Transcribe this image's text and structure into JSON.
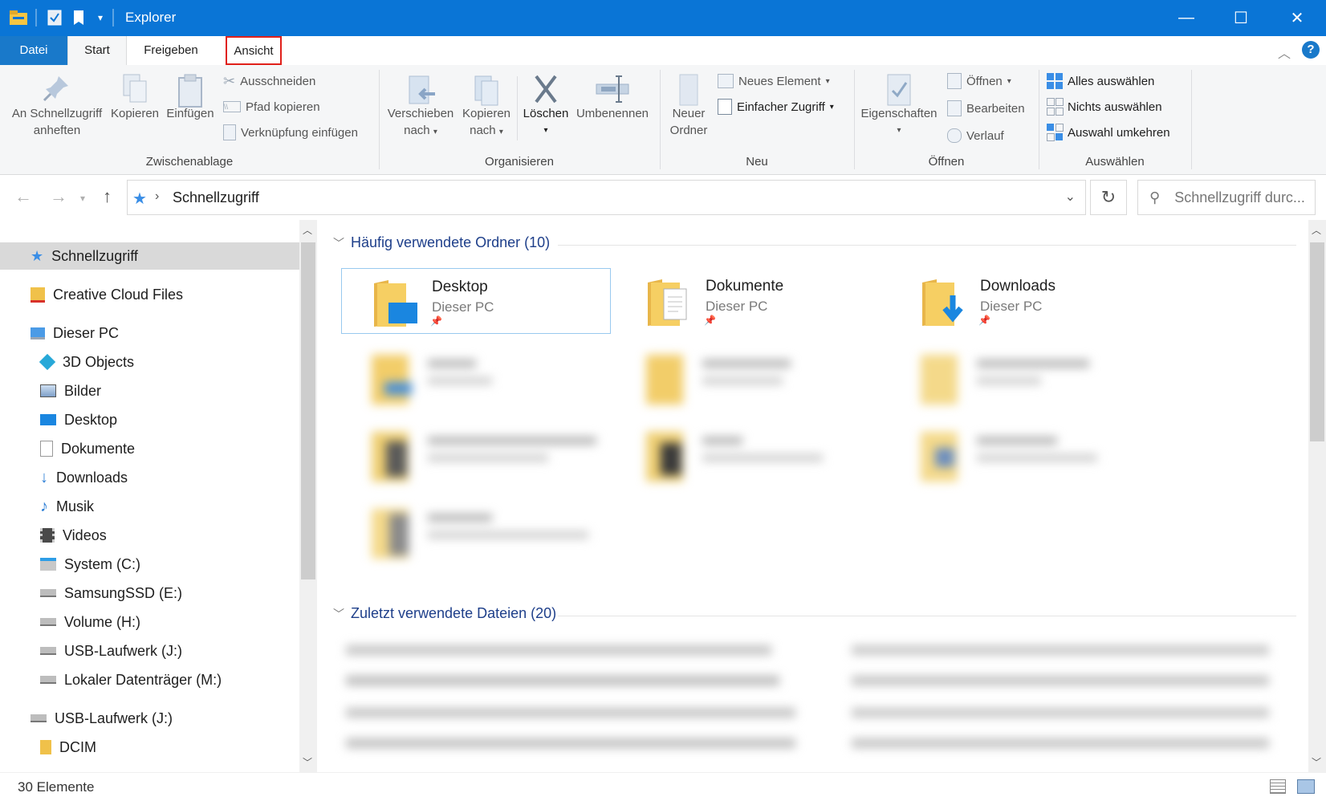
{
  "window": {
    "title": "Explorer",
    "minimize": "—",
    "maximize": "☐",
    "close": "✕"
  },
  "ribbon_tabs": {
    "datei": "Datei",
    "start": "Start",
    "freigeben": "Freigeben",
    "ansicht": "Ansicht"
  },
  "ribbon": {
    "zwischenablage": {
      "label": "Zwischenablage",
      "pin_line1": "An Schnellzugriff",
      "pin_line2": "anheften",
      "copy": "Kopieren",
      "paste": "Einfügen",
      "cut": "Ausschneiden",
      "copy_path": "Pfad kopieren",
      "paste_shortcut": "Verknüpfung einfügen"
    },
    "organisieren": {
      "label": "Organisieren",
      "move_line1": "Verschieben",
      "move_line2": "nach",
      "copyto_line1": "Kopieren",
      "copyto_line2": "nach",
      "delete": "Löschen",
      "rename": "Umbenennen"
    },
    "neu": {
      "label": "Neu",
      "folder_line1": "Neuer",
      "folder_line2": "Ordner",
      "new_item": "Neues Element",
      "easy_access": "Einfacher Zugriff"
    },
    "oeffnen": {
      "label": "Öffnen",
      "properties": "Eigenschaften",
      "open": "Öffnen",
      "edit": "Bearbeiten",
      "history": "Verlauf"
    },
    "auswaehlen": {
      "label": "Auswählen",
      "select_all": "Alles auswählen",
      "select_none": "Nichts auswählen",
      "invert": "Auswahl umkehren"
    }
  },
  "address": {
    "path": "Schnellzugriff",
    "search_placeholder": "Schnellzugriff durc..."
  },
  "nav": {
    "items": [
      {
        "label": "Schnellzugriff"
      },
      {
        "label": "Creative Cloud Files"
      },
      {
        "label": "Dieser PC"
      },
      {
        "label": "3D Objects"
      },
      {
        "label": "Bilder"
      },
      {
        "label": "Desktop"
      },
      {
        "label": "Dokumente"
      },
      {
        "label": "Downloads"
      },
      {
        "label": "Musik"
      },
      {
        "label": "Videos"
      },
      {
        "label": "System (C:)"
      },
      {
        "label": "SamsungSSD (E:)"
      },
      {
        "label": "Volume (H:)"
      },
      {
        "label": "USB-Laufwerk (J:)"
      },
      {
        "label": "Lokaler Datenträger (M:)"
      },
      {
        "label": "USB-Laufwerk (J:)"
      },
      {
        "label": "DCIM"
      }
    ]
  },
  "content": {
    "frequent_header": "Häufig verwendete Ordner (10)",
    "recent_header": "Zuletzt verwendete Dateien (20)",
    "folders": [
      {
        "name": "Desktop",
        "location": "Dieser PC"
      },
      {
        "name": "Dokumente",
        "location": "Dieser PC"
      },
      {
        "name": "Downloads",
        "location": "Dieser PC"
      }
    ]
  },
  "status": {
    "count": "30 Elemente"
  }
}
